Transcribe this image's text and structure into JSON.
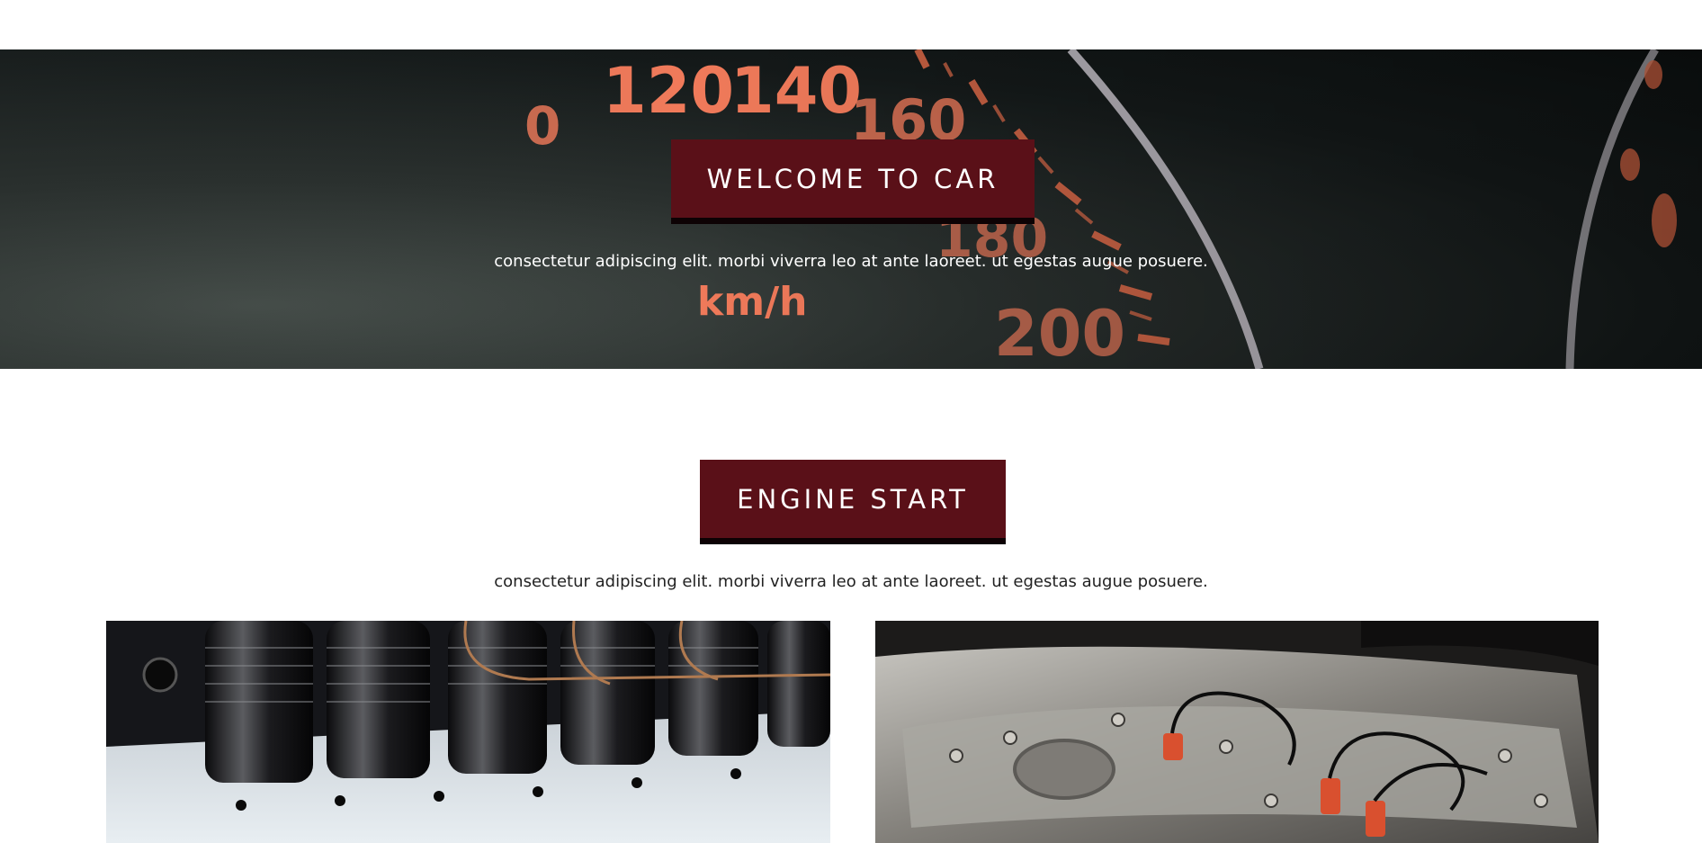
{
  "hero": {
    "title": "WELCOME TO CAR",
    "subtitle": "consectetur adipiscing elit. morbi viverra leo at ante laoreet. ut egestas augue posuere.",
    "gauge_labels": [
      "0",
      "120",
      "140",
      "160",
      "180",
      "200",
      "km/h"
    ]
  },
  "engine": {
    "title": "ENGINE START",
    "subtitle": "consectetur adipiscing elit. morbi viverra leo at ante laoreet. ut egestas augue posuere."
  },
  "colors": {
    "accent": "#5a1018",
    "accent_shadow": "#0d0204",
    "gauge_orange": "#f07a5a"
  }
}
